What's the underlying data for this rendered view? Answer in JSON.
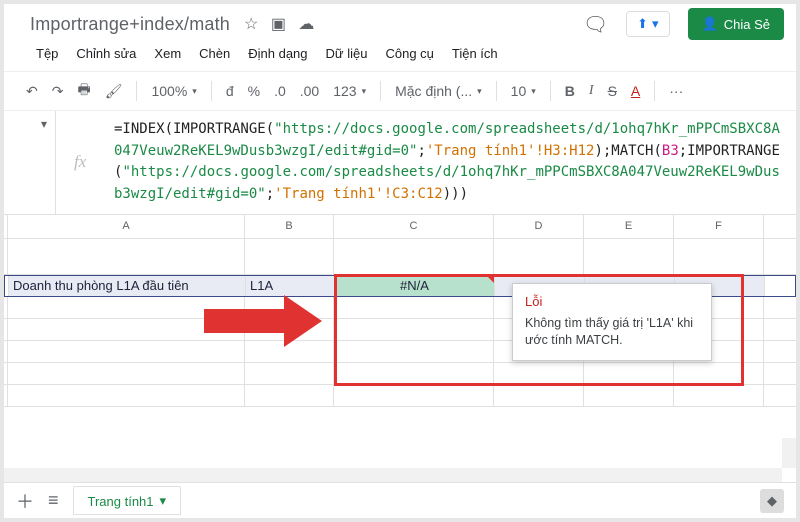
{
  "title": "Importrange+index/math",
  "menubar": [
    "Tệp",
    "Chỉnh sửa",
    "Xem",
    "Chèn",
    "Định dạng",
    "Dữ liệu",
    "Công cụ",
    "Tiện ích"
  ],
  "share_label": "Chia Sẻ",
  "toolbar": {
    "zoom": "100%",
    "currency": "đ",
    "percent": "%",
    "dec_dec": ".0",
    "dec_inc": ".00",
    "more_fmt": "123",
    "font": "Mặc định (...",
    "size": "10",
    "bold": "B",
    "italic": "I",
    "strike": "S",
    "color": "A",
    "more": "···"
  },
  "formula": {
    "p1": "=INDEX(IMPORTRANGE(",
    "url1": "\"https://docs.google.com/spreadsheets/d/1ohq7hKr_mPPCmSBXC8A047Veuw2ReKEL9wDusb3wzgI/edit#gid=0\"",
    "p2": ";",
    "r1": "'Trang tính1'!H3:H12",
    "p3": ");MATCH(",
    "r2": "B3",
    "p4": ";IMPORTRANGE(",
    "url2": "\"https://docs.google.com/spreadsheets/d/1ohq7hKr_mPPCmSBXC8A047Veuw2ReKEL9wDusb3wzgI/edit#gid=0\"",
    "p5": ";",
    "r3": "'Trang tính1'!C3:C12",
    "p6": ")))"
  },
  "cols": [
    "A",
    "B",
    "C",
    "D",
    "E",
    "F"
  ],
  "row3": {
    "A": "Doanh thu phòng L1A đầu tiên",
    "B": "L1A",
    "C": "#N/A"
  },
  "tooltip": {
    "title": "Lỗi",
    "body": "Không tìm thấy giá trị 'L1A' khi ước tính MATCH."
  },
  "tab_name": "Trang tính1",
  "namebox_caret": "▾"
}
